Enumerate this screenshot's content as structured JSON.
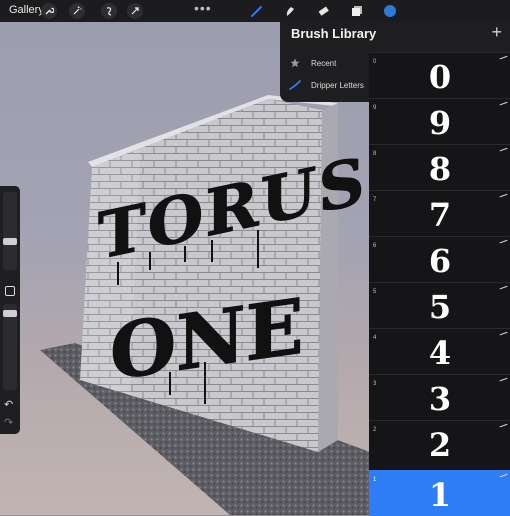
{
  "toolbar": {
    "gallery_label": "Gallery",
    "more_label": "•••",
    "left_tools": [
      "wrench-icon",
      "magic-wand-icon",
      "selection-icon",
      "transform-icon"
    ],
    "right_tools": [
      "brush-icon",
      "smudge-icon",
      "eraser-icon",
      "layers-icon",
      "color-icon"
    ],
    "accent": "#2f7df6",
    "color_swatch": "#2a7bd8"
  },
  "sidebar": {
    "size_level": 0.7,
    "opacity_level": 0.3
  },
  "canvas": {
    "wall_text_line1": "TORUS",
    "wall_text_line2": "ONE"
  },
  "panel": {
    "title": "Brush Library",
    "add_label": "+",
    "categories": [
      {
        "label": "Recent",
        "icon": "star-icon"
      },
      {
        "label": "Dripper Letters",
        "icon": "brush-stroke-icon"
      }
    ]
  },
  "brushes": [
    {
      "number": "0",
      "glyph": "0"
    },
    {
      "number": "9",
      "glyph": "9"
    },
    {
      "number": "8",
      "glyph": "8"
    },
    {
      "number": "7",
      "glyph": "7"
    },
    {
      "number": "6",
      "glyph": "6"
    },
    {
      "number": "5",
      "glyph": "5"
    },
    {
      "number": "4",
      "glyph": "4"
    },
    {
      "number": "3",
      "glyph": "3"
    },
    {
      "number": "2",
      "glyph": "2"
    },
    {
      "number": "1",
      "glyph": "1",
      "selected": true
    }
  ]
}
